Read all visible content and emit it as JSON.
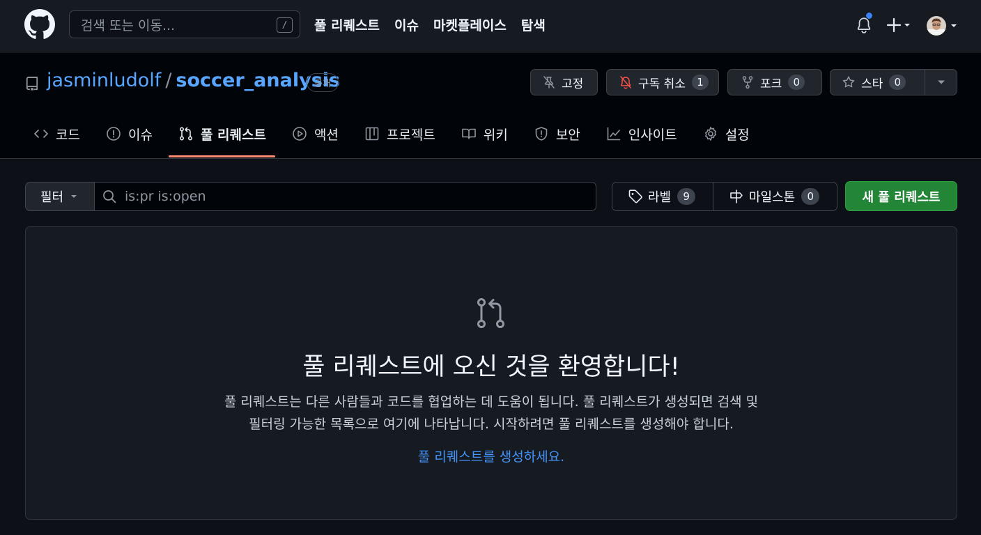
{
  "header": {
    "search_placeholder": "검색 또는 이동...",
    "search_shortcut": "/",
    "nav": [
      "풀 리퀘스트",
      "이슈",
      "마켓플레이스",
      "탐색"
    ],
    "notification_dot_color": "#3b82f6"
  },
  "repo": {
    "owner": "jasminludolf",
    "separator": "/",
    "name": "soccer_analysis",
    "visibility": "공개",
    "actions": {
      "pin_label": "고정",
      "unwatch_label": "구독 취소",
      "unwatch_count": "1",
      "fork_label": "포크",
      "fork_count": "0",
      "star_label": "스타",
      "star_count": "0"
    }
  },
  "tabs": [
    {
      "label": "코드",
      "icon": "code-icon"
    },
    {
      "label": "이슈",
      "icon": "issue-icon"
    },
    {
      "label": "풀 리퀘스트",
      "icon": "pull-request-icon",
      "active": true
    },
    {
      "label": "액션",
      "icon": "play-icon"
    },
    {
      "label": "프로젝트",
      "icon": "table-icon"
    },
    {
      "label": "위키",
      "icon": "book-icon"
    },
    {
      "label": "보안",
      "icon": "shield-icon"
    },
    {
      "label": "인사이트",
      "icon": "graph-icon"
    },
    {
      "label": "설정",
      "icon": "gear-icon"
    }
  ],
  "toolbar": {
    "filter_label": "필터",
    "filter_query": "is:pr is:open",
    "labels_label": "라벨",
    "labels_count": "9",
    "milestones_label": "마일스톤",
    "milestones_count": "0",
    "new_pr_label": "새 풀 리퀘스트",
    "accent_color": "#238636",
    "active_tab_color": "#fd8c73"
  },
  "blankslate": {
    "title": "풀 리퀘스트에 오신 것을 환영합니다!",
    "description_line1": "풀 리퀘스트는 다른 사람들과 코드를 협업하는 데 도움이 됩니다. 풀 리퀘스트가 생성되면 검색 및",
    "description_line2": "필터링 가능한 목록으로 여기에 나타납니다. 시작하려면 풀 리퀘스트를 생성해야 합니다.",
    "link_label": "풀 리퀘스트를 생성하세요."
  }
}
